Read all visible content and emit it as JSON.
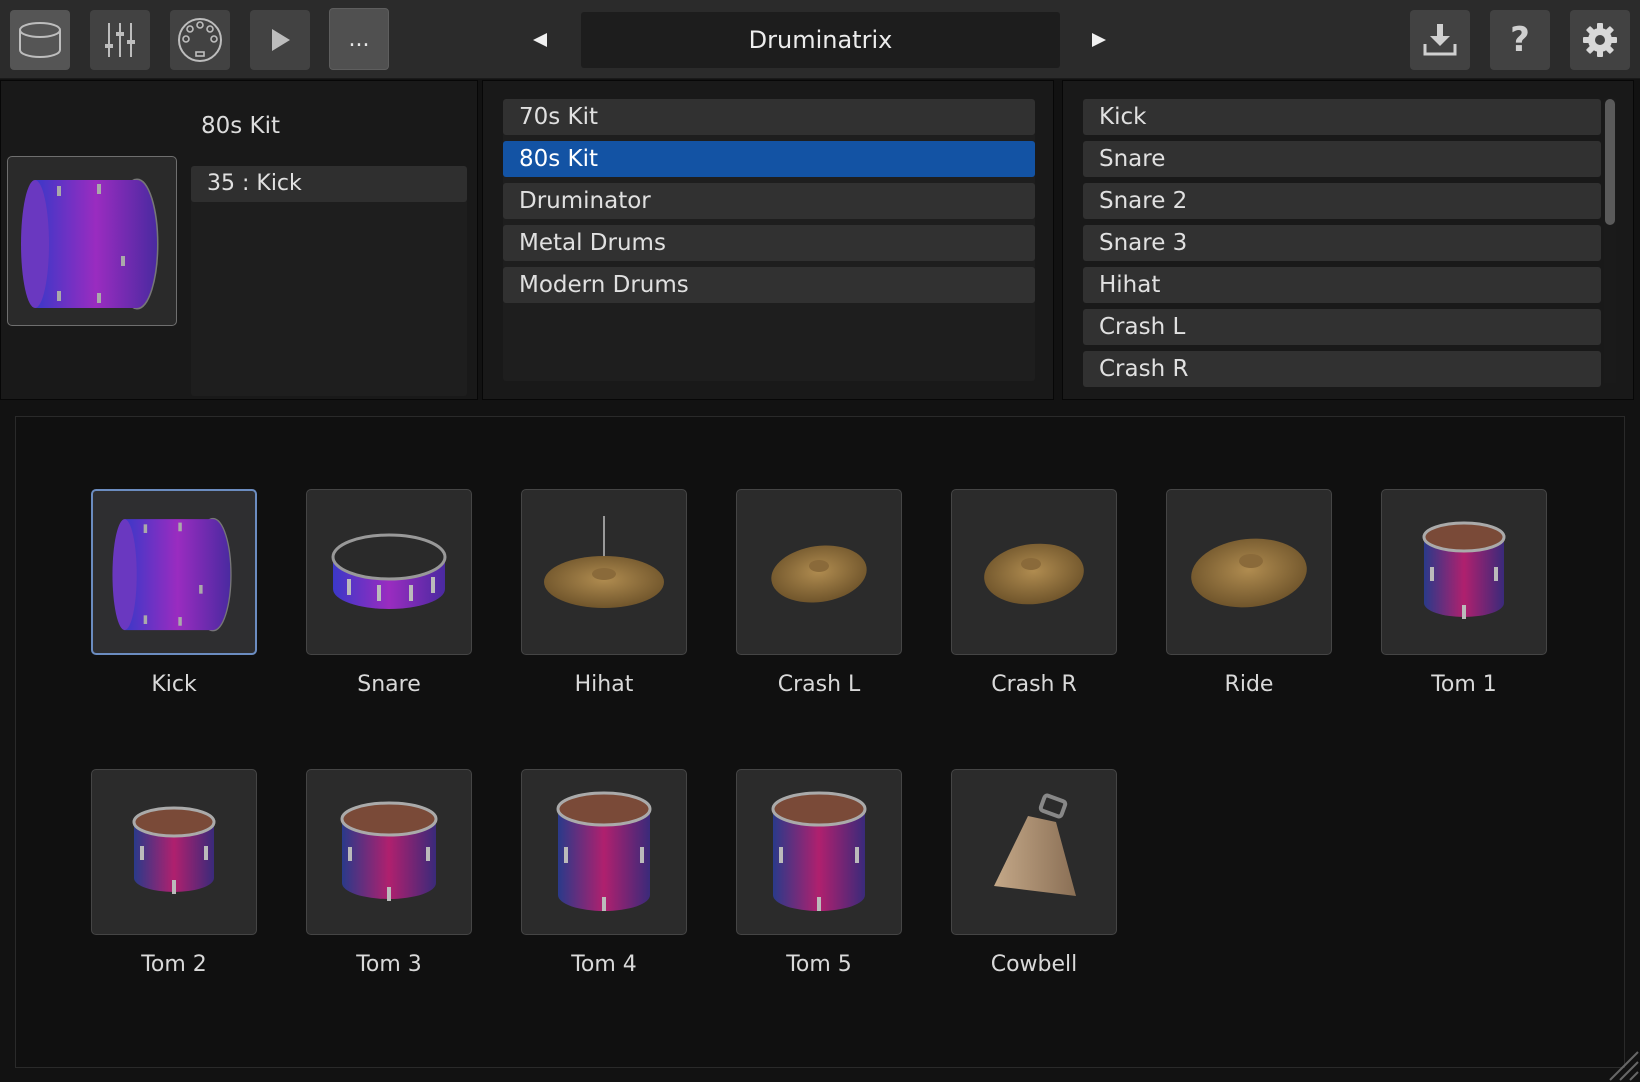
{
  "toolbar": {
    "buttons": [
      {
        "icon": "drum-kit-icon"
      },
      {
        "icon": "mixer-sliders-icon"
      },
      {
        "icon": "midi-connector-icon"
      },
      {
        "icon": "play-icon"
      },
      {
        "label": "..."
      }
    ],
    "prev_icon": "triangle-left-icon",
    "next_icon": "triangle-right-icon",
    "preset_name": "Druminatrix",
    "right_buttons": [
      {
        "icon": "download-icon"
      },
      {
        "icon": "help-icon",
        "label": "?"
      },
      {
        "icon": "gear-icon"
      }
    ]
  },
  "kit_panel": {
    "kit_name": "80s Kit",
    "selected_note": "35 : Kick"
  },
  "kits_list": {
    "items": [
      "70s Kit",
      "80s Kit",
      "Druminator",
      "Metal Drums",
      "Modern Drums"
    ],
    "selected": "80s Kit"
  },
  "instruments_list": {
    "items": [
      "Kick",
      "Snare",
      "Snare 2",
      "Snare 3",
      "Hihat",
      "Crash L",
      "Crash R"
    ]
  },
  "drum_grid": {
    "pads": [
      {
        "label": "Kick",
        "icon": "kick-drum-icon",
        "selected": true
      },
      {
        "label": "Snare",
        "icon": "snare-drum-icon"
      },
      {
        "label": "Hihat",
        "icon": "hihat-cymbal-icon"
      },
      {
        "label": "Crash L",
        "icon": "crash-cymbal-icon"
      },
      {
        "label": "Crash R",
        "icon": "crash-cymbal-icon"
      },
      {
        "label": "Ride",
        "icon": "ride-cymbal-icon"
      },
      {
        "label": "Tom 1",
        "icon": "tom-drum-icon"
      },
      {
        "label": "Tom 2",
        "icon": "tom-drum-icon"
      },
      {
        "label": "Tom 3",
        "icon": "tom-drum-icon"
      },
      {
        "label": "Tom 4",
        "icon": "floor-tom-icon"
      },
      {
        "label": "Tom 5",
        "icon": "floor-tom-icon"
      },
      {
        "label": "Cowbell",
        "icon": "cowbell-icon"
      }
    ]
  },
  "colors": {
    "selection_blue": "#1353a4",
    "selected_pad_border": "#6b8cc0",
    "drum_purple": "#7a2fb0",
    "drum_magenta": "#b0206e",
    "cymbal_bronze": "#8a6a3a"
  }
}
